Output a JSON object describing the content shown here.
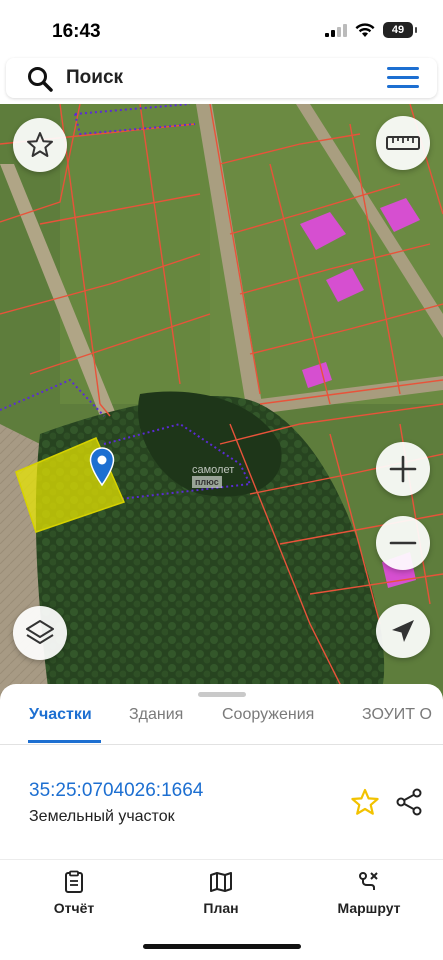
{
  "status_bar": {
    "time": "16:43",
    "battery": "49"
  },
  "search": {
    "label": "Поиск",
    "placeholder": "Поиск"
  },
  "map": {
    "watermark_line1": "самолет",
    "watermark_line2": "плюс",
    "colors": {
      "parcel_line": "#e8533a",
      "selected_fill": "#e9e600",
      "district_dash": "#5b2bd6",
      "pin": "#1d6fd1"
    }
  },
  "sheet": {
    "tabs": [
      {
        "label": "Участки",
        "active": true
      },
      {
        "label": "Здания",
        "active": false
      },
      {
        "label": "Сооружения",
        "active": false
      },
      {
        "label": "ЗОУИТ О",
        "active": false
      }
    ],
    "parcel": {
      "cadastral_number": "35:25:0704026:1664",
      "type": "Земельный участок"
    }
  },
  "bottom_nav": [
    {
      "label": "Отчёт",
      "icon": "report-icon"
    },
    {
      "label": "План",
      "icon": "map-plan-icon"
    },
    {
      "label": "Маршрут",
      "icon": "route-icon"
    }
  ],
  "accent_color": "#1d6fd1",
  "favorite_color": "#f2c200"
}
